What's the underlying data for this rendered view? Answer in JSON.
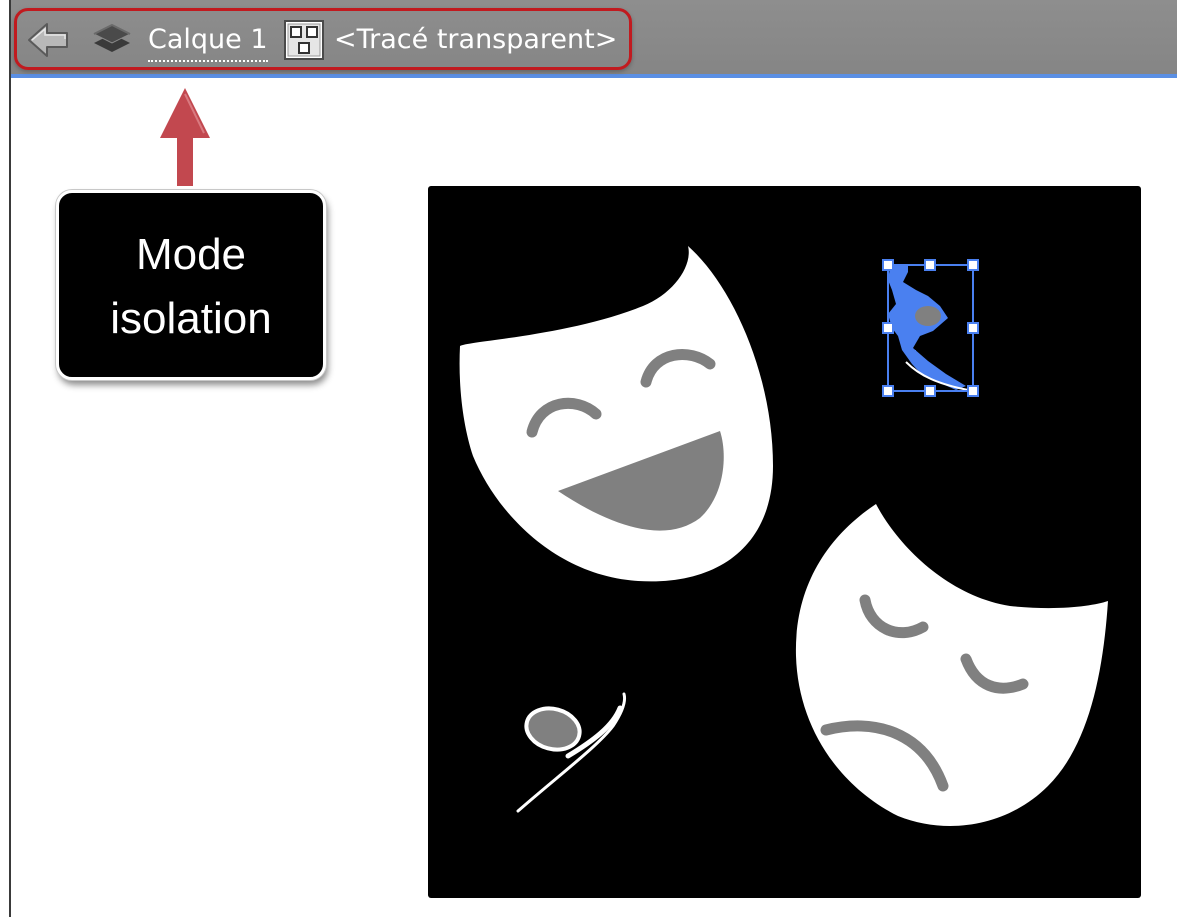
{
  "isolation_bar": {
    "back_icon": "back-arrow-icon",
    "layers_icon": "layers-icon",
    "layer_name": "Calque 1",
    "group_icon": "group-icon",
    "object_name": "<Tracé transparent>"
  },
  "annotation": {
    "callout_line1": "Mode",
    "callout_line2": "isolation",
    "arrow_icon": "up-arrow-icon"
  },
  "colors": {
    "bar": "#888888",
    "highlight": "#c11a1f",
    "selection": "#4a80f0",
    "artboard": "#000000",
    "mask": "#ffffff",
    "mask_feature": "#808080"
  }
}
